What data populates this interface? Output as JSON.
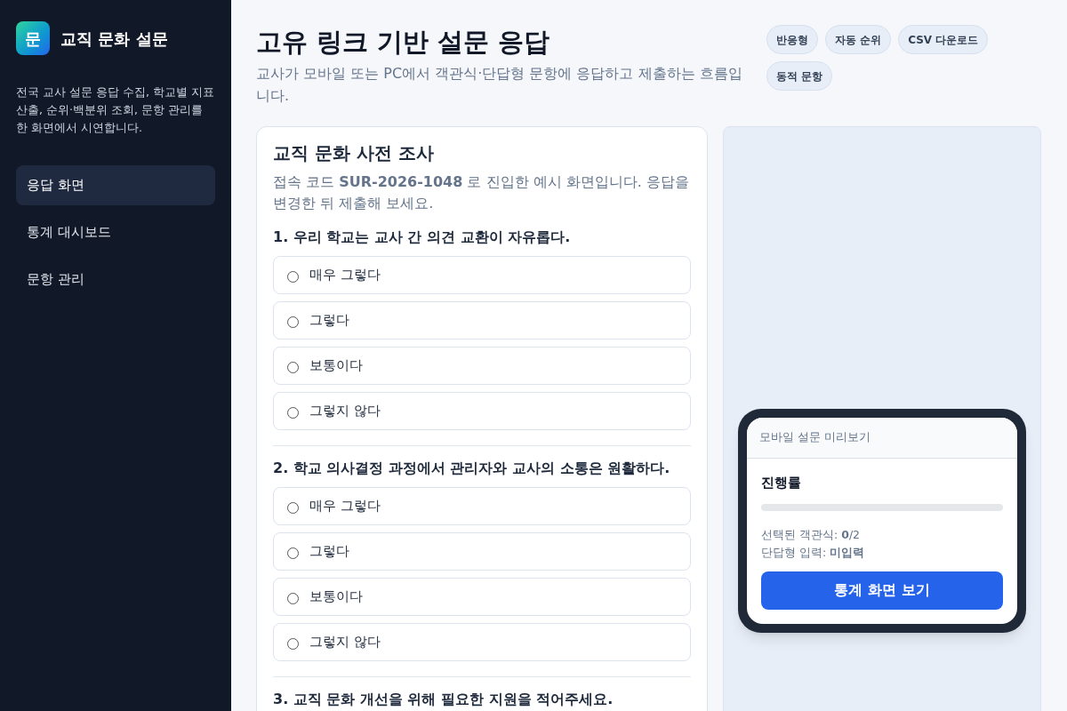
{
  "sidebar": {
    "logo": "문",
    "title": "교직 문화 설문",
    "description": "전국 교사 설문 응답 수집, 학교별 지표 산출, 순위·백분위 조회, 문항 관리를 한 화면에서 시연합니다.",
    "nav": [
      {
        "label": "응답 화면",
        "selected": true
      },
      {
        "label": "통계 대시보드",
        "selected": false
      },
      {
        "label": "문항 관리",
        "selected": false
      }
    ]
  },
  "header": {
    "title": "고유 링크 기반 설문 응답",
    "subtitle": "교사가 모바일 또는 PC에서 객관식·단답형 문항에 응답하고 제출하는 흐름입니다.",
    "chips": [
      "반응형",
      "자동 순위",
      "CSV 다운로드",
      "동적 문항"
    ]
  },
  "survey": {
    "title": "교직 문화 사전 조사",
    "description": "접속 코드 **SUR-2026-1048** 로 진입한 예시 화면입니다. 응답을 변경한 뒤 제출해 보세요.",
    "questions": [
      {
        "title": "1. 우리 학교는 교사 간 의견 교환이 자유롭다.",
        "options": [
          {
            "label": "매우 그렇다",
            "selected": false
          },
          {
            "label": "그렇다",
            "selected": false
          },
          {
            "label": "보통이다",
            "selected": false
          },
          {
            "label": "그렇지 않다",
            "selected": false
          }
        ]
      },
      {
        "title": "2. 학교 의사결정 과정에서 관리자와 교사의 소통은 원활하다.",
        "options": [
          {
            "label": "매우 그렇다",
            "selected": false
          },
          {
            "label": "그렇다",
            "selected": false
          },
          {
            "label": "보통이다",
            "selected": false
          },
          {
            "label": "그렇지 않다",
            "selected": false
          }
        ]
      },
      {
        "title": "3. 교직 문화 개선을 위해 필요한 지원을 적어주세요."
      }
    ]
  },
  "mobile_preview": {
    "header": "모바일 설문 미리보기",
    "progress_label": "진행률",
    "progress": {
      "level": 0
    },
    "stats": [
      "선택된 객관식: **0**/2",
      "단답형 입력: **미입력**"
    ],
    "button": "통계 화면 보기"
  }
}
